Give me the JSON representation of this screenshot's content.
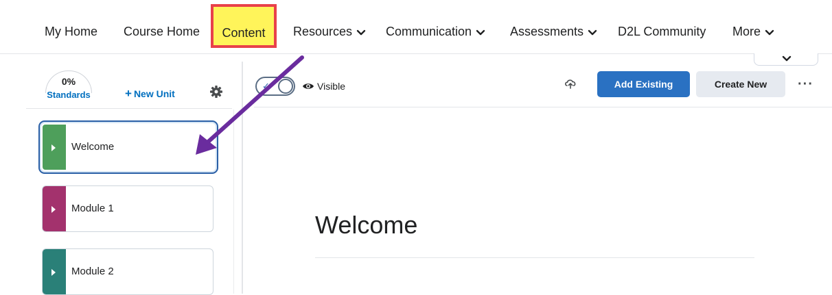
{
  "nav": {
    "items": [
      {
        "label": "My Home"
      },
      {
        "label": "Course Home"
      },
      {
        "label": "Content",
        "highlighted": true
      },
      {
        "label": "Resources",
        "dropdown": true
      },
      {
        "label": "Communication",
        "dropdown": true
      },
      {
        "label": "Assessments",
        "dropdown": true
      },
      {
        "label": "D2L Community"
      },
      {
        "label": "More",
        "dropdown": true
      }
    ]
  },
  "sidebar": {
    "standards_percent": "0%",
    "standards_label": "Standards",
    "new_unit_label": "New Unit",
    "modules": [
      {
        "label": "Welcome",
        "color": "#4e9f5b",
        "selected": true
      },
      {
        "label": "Module 1",
        "color": "#a3326d"
      },
      {
        "label": "Module 2",
        "color": "#2a8078"
      }
    ]
  },
  "toolbar": {
    "visibility_label": "Visible",
    "add_existing_label": "Add Existing",
    "create_new_label": "Create New"
  },
  "main": {
    "title": "Welcome"
  },
  "colors": {
    "highlight_fill": "#fff45a",
    "highlight_border": "#e8414a",
    "primary_button": "#2a71c2",
    "arrow": "#6a2c9e",
    "link": "#006fbf"
  },
  "icons": [
    "chevron-down-icon",
    "gear-icon",
    "plus-icon",
    "eye-icon",
    "cloud-upload-icon",
    "more-options-icon",
    "caret-right-icon",
    "check-icon"
  ]
}
